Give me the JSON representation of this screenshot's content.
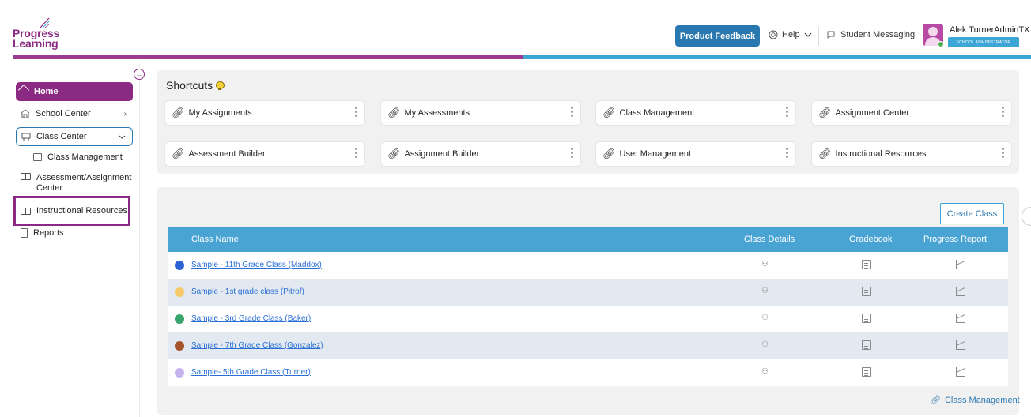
{
  "header": {
    "logo_line1": "Progress",
    "logo_line2": "Learning",
    "feedback_label": "Product Feedback",
    "help_label": "Help",
    "messaging_label": "Student Messaging",
    "user_name": "Alek TurnerAdminTX",
    "user_role": "SCHOOL ADMINISTRATOR",
    "colors": {
      "purple": "#8b2a82",
      "blue": "#3ea6d6",
      "button_blue": "#2a78b0"
    }
  },
  "sidebar": {
    "home": "Home",
    "school_center": "School Center",
    "class_center": "Class Center",
    "class_management": "Class Management",
    "assessment_center": "Assessment/Assignment Center",
    "instructional_resources": "Instructional Resources",
    "reports": "Reports"
  },
  "shortcuts": {
    "title": "Shortcuts",
    "items": [
      "My Assignments",
      "My Assessments",
      "Class Management",
      "Assignment Center",
      "Assessment Builder",
      "Assignment Builder",
      "User Management",
      "Instructional Resources"
    ]
  },
  "classes": {
    "create_label": "Create Class",
    "columns": [
      "Class Name",
      "Class Details",
      "Gradebook",
      "Progress Report"
    ],
    "rows": [
      {
        "name": "Sample - 11th Grade Class (Maddox)",
        "color": "#2b63d6"
      },
      {
        "name": "Sample - 1st grade class (Pitrof)",
        "color": "#f7c96b"
      },
      {
        "name": "Sample - 3rd Grade Class (Baker)",
        "color": "#3aa56a"
      },
      {
        "name": "Sample - 7th Grade Class (Gonzalez)",
        "color": "#a5532a"
      },
      {
        "name": "Sample- 5th Grade Class (Turner)",
        "color": "#c6b4ef"
      }
    ],
    "footer_link": "Class Management"
  }
}
